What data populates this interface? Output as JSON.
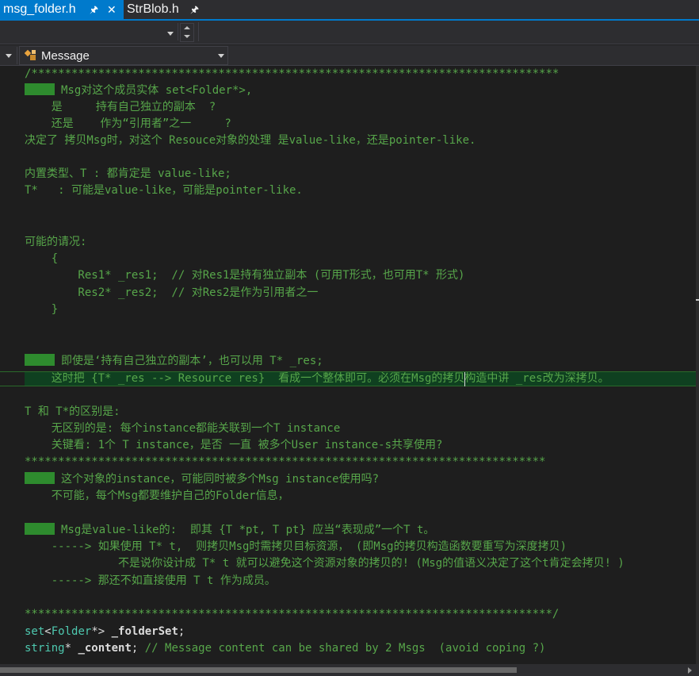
{
  "tabs": [
    {
      "label": "msg_folder.h",
      "active": true,
      "pin": "pin-icon",
      "close": "close-icon"
    },
    {
      "label": "StrBlob.h",
      "active": false,
      "pin": "pin-icon"
    }
  ],
  "navbar": {
    "member_combo": {
      "value": "Message",
      "icon": "class-icon"
    }
  },
  "colors": {
    "accent": "#007acc",
    "comment": "#57a64a",
    "type": "#4ec9b0",
    "identifier": "#dcdcdc",
    "bookmark": "#2e8b2e",
    "current_line": "#0f4020",
    "editor_bg": "#1e1e1e"
  },
  "code": {
    "l0": "/*******************************************************************************",
    "l1": "Msg对这个成员实体 set<Folder*>,",
    "l2": "    是     持有自己独立的副本  ?",
    "l3": "    还是    作为“引用者”之一     ?",
    "l4": "决定了 拷贝Msg时，对这个 Resouce对象的处理 是value-like，还是pointer-like.",
    "l6": "内置类型、T : 都肯定是 value-like;",
    "l7": "T*   : 可能是value-like，可能是pointer-like.",
    "l10": "可能的请况:",
    "l11": "    {",
    "l12": "        Res1* _res1;  // 对Res1是持有独立副本 (可用T形式，也可用T* 形式)",
    "l13": "        Res2* _res2;  // 对Res2是作为引用者之一",
    "l14": "    }",
    "l17": "即使是‘持有自己独立的副本’，也可以用 T* _res;",
    "l18": "    这时把 {T* _res --> Resource res}  看成一个整体即可。必须在Msg的拷贝构造中讲 _res改为深拷贝。",
    "l20": "T 和 T*的区别是:",
    "l21": "    无区别的是: 每个instance都能关联到一个T instance",
    "l22": "    关键看: 1个 T instance，是否 一直 被多个User instance-s共享使用?",
    "l23": "******************************************************************************",
    "l24": "这个对象的instance，可能同时被多个Msg instance使用吗?",
    "l25": "    不可能，每个Msg都要维护自己的Folder信息，",
    "l27": "Msg是value-like的:  即其 {T *pt, T pt} 应当“表现成”一个T t。",
    "l28": "    -----> 如果使用 T* t,  则拷贝Msg时需拷贝目标资源， (即Msg的拷贝构造函数要重写为深度拷贝)",
    "l29": "              不是说你设计成 T* t 就可以避免这个资源对象的拷贝的! (Msg的值语义决定了这个t肯定会拷贝! )",
    "l30": "    -----> 那还不如直接使用 T t 作为成员。",
    "l32": "*******************************************************************************/",
    "l33": {
      "type": "set",
      "lt": "<",
      "arg": "Folder",
      "ptr": "*> ",
      "name": "_folderSet",
      "semi": ";"
    },
    "l34": {
      "type": "string",
      "ptr": "* ",
      "name": "_content",
      "semi": "; ",
      "comment": "// Message content can be shared by 2 Msgs  (avoid coping ?)"
    }
  }
}
